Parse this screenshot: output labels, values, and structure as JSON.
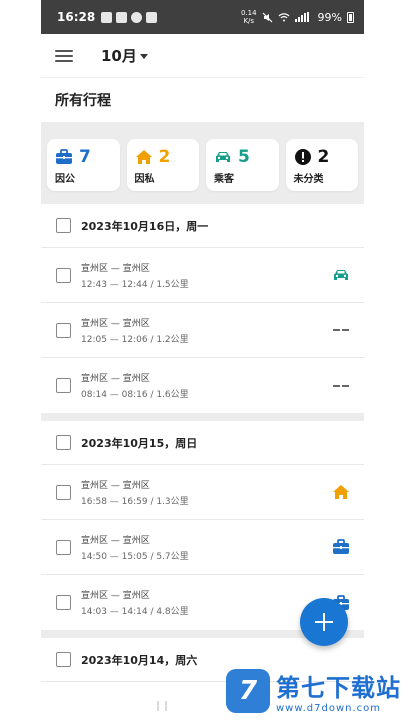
{
  "status_bar": {
    "time": "16:28",
    "net_speed_value": "0.14",
    "net_speed_unit": "K/s",
    "battery": "99%"
  },
  "app_bar": {
    "month": "10月"
  },
  "section_title": "所有行程",
  "categories": [
    {
      "name": "因公",
      "count": "7",
      "icon": "briefcase-icon",
      "color": "#1e6fc7"
    },
    {
      "name": "因私",
      "count": "2",
      "icon": "home-icon",
      "color": "#f0a000"
    },
    {
      "name": "乘客",
      "count": "5",
      "icon": "car-icon",
      "color": "#159e8c"
    },
    {
      "name": "未分类",
      "count": "2",
      "icon": "exclamation-icon",
      "color": "#111111"
    }
  ],
  "days": [
    {
      "date": "2023年10月16日，周一",
      "trips": [
        {
          "route": "宣州区 — 宣州区",
          "time": "12:43 — 12:44 / 1.5公里",
          "category": "car-icon"
        },
        {
          "route": "宣州区 — 宣州区",
          "time": "12:05 — 12:06 / 1.2公里",
          "category": "dash-icon"
        },
        {
          "route": "宣州区 — 宣州区",
          "time": "08:14 — 08:16 / 1.6公里",
          "category": "dash-icon"
        }
      ]
    },
    {
      "date": "2023年10月15，周日",
      "trips": [
        {
          "route": "宣州区 — 宣州区",
          "time": "16:58 — 16:59 / 1.3公里",
          "category": "home-icon"
        },
        {
          "route": "宣州区 — 宣州区",
          "time": "14:50 — 15:05 / 5.7公里",
          "category": "briefcase-icon"
        },
        {
          "route": "宣州区 — 宣州区",
          "time": "14:03 — 14:14 / 4.8公里",
          "category": "briefcase-icon"
        }
      ]
    },
    {
      "date": "2023年10月14，周六",
      "trips": []
    }
  ],
  "watermark": {
    "logo_letter": "7",
    "brand": "第七下载站",
    "url": "www.d7down.com"
  }
}
